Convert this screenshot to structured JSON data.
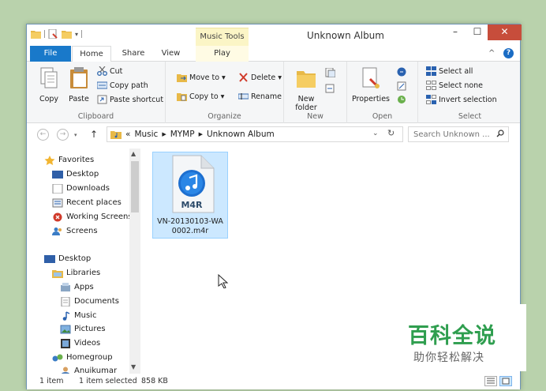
{
  "titlebar": {
    "title": "Unknown Album",
    "context_tab": "Music Tools",
    "minimize": "–",
    "maximize": "☐",
    "close": "✕"
  },
  "tabs": {
    "file": "File",
    "home": "Home",
    "share": "Share",
    "view": "View",
    "play": "Play",
    "collapse": "^",
    "help": "?"
  },
  "ribbon": {
    "clipboard": {
      "label": "Clipboard",
      "copy": "Copy",
      "paste": "Paste",
      "cut": "Cut",
      "copy_path": "Copy path",
      "paste_shortcut": "Paste shortcut"
    },
    "organize": {
      "label": "Organize",
      "move_to": "Move to ▾",
      "copy_to": "Copy to ▾",
      "delete": "Delete ▾",
      "rename": "Rename"
    },
    "new": {
      "label": "New",
      "new_folder_line1": "New",
      "new_folder_line2": "folder"
    },
    "open": {
      "label": "Open",
      "properties": "Properties"
    },
    "select": {
      "label": "Select",
      "select_all": "Select all",
      "select_none": "Select none",
      "invert_selection": "Invert selection"
    }
  },
  "address": {
    "back": "←",
    "forward": "→",
    "up": "↑",
    "overflow": "«",
    "crumbs": [
      "Music",
      "MYMP",
      "Unknown Album"
    ],
    "search_placeholder": "Search Unknown ..."
  },
  "nav": {
    "favorites": "Favorites",
    "desktop1": "Desktop",
    "downloads": "Downloads",
    "recent_places": "Recent places",
    "working_screens": "Working Screens",
    "screens": "Screens",
    "desktop2": "Desktop",
    "libraries": "Libraries",
    "apps": "Apps",
    "documents": "Documents",
    "music": "Music",
    "pictures": "Pictures",
    "videos": "Videos",
    "homegroup": "Homegroup",
    "anuikumar": "Anuikumar"
  },
  "file": {
    "badge": "M4R",
    "name_line1": "VN-20130103-WA",
    "name_line2": "0002.m4r"
  },
  "status": {
    "count": "1 item",
    "selected": "1 item selected",
    "size": "858 KB"
  },
  "watermark": {
    "title": "百科全说",
    "subtitle": "助你轻松解决"
  },
  "colors": {
    "file_tab": "#1979ca",
    "close_button": "#c74d3b",
    "selection": "#cce8ff",
    "context_tab": "#fbf5c6",
    "watermark_green": "#2f9e4f"
  }
}
